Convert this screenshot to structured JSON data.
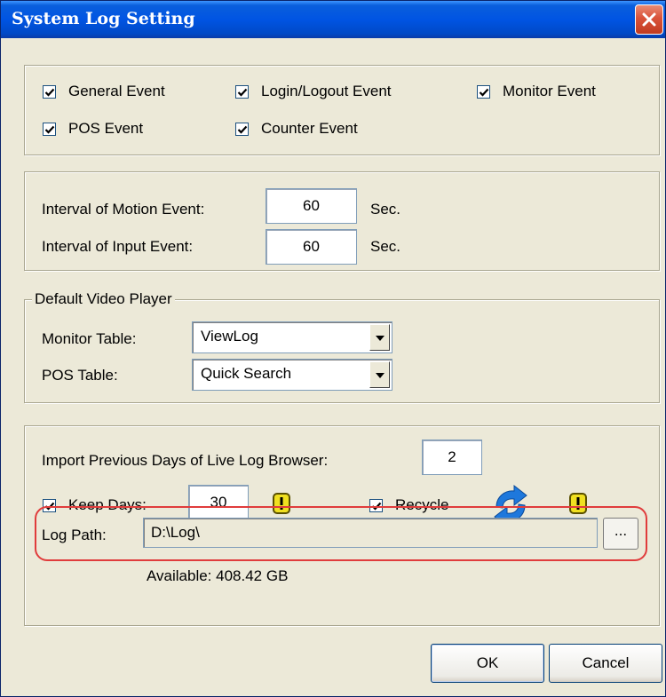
{
  "window": {
    "title": "System Log Setting"
  },
  "events": [
    {
      "label": "General Event",
      "checked": true
    },
    {
      "label": "Login/Logout Event",
      "checked": true
    },
    {
      "label": "Monitor Event",
      "checked": true
    },
    {
      "label": "POS Event",
      "checked": true
    },
    {
      "label": "Counter Event",
      "checked": true
    }
  ],
  "intervals": {
    "motion_label": "Interval of Motion Event:",
    "motion_value": "60",
    "input_label": "Interval of Input Event:",
    "input_value": "60",
    "unit": "Sec."
  },
  "player": {
    "legend": "Default Video Player",
    "monitor_label": "Monitor Table:",
    "monitor_value": "ViewLog",
    "pos_label": "POS Table:",
    "pos_value": "Quick Search"
  },
  "log": {
    "import_label": "Import Previous Days of Live Log Browser:",
    "import_value": "2",
    "keep_label": "Keep Days:",
    "keep_checked": true,
    "keep_value": "30",
    "recycle_label": "Recycle",
    "recycle_checked": true,
    "path_label": "Log Path:",
    "path_value": "D:\\Log\\",
    "browse_label": "...",
    "available": "Available:  408.42 GB"
  },
  "buttons": {
    "ok": "OK",
    "cancel": "Cancel"
  },
  "colors": {
    "titlebar": "#0054e3",
    "highlight": "#e03c3c",
    "warning": "#f0e020",
    "recycle": "#1e78dc"
  }
}
